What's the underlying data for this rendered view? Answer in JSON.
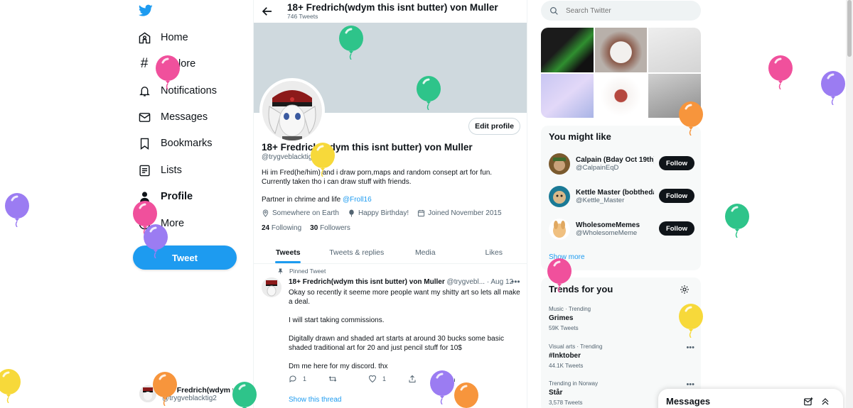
{
  "nav": {
    "items": [
      {
        "label": "Home",
        "icon": "home-icon"
      },
      {
        "label": "Explore",
        "icon": "hashtag-icon"
      },
      {
        "label": "Notifications",
        "icon": "bell-icon"
      },
      {
        "label": "Messages",
        "icon": "envelope-icon"
      },
      {
        "label": "Bookmarks",
        "icon": "bookmark-icon"
      },
      {
        "label": "Lists",
        "icon": "list-icon"
      },
      {
        "label": "Profile",
        "icon": "person-icon"
      },
      {
        "label": "More",
        "icon": "more-circle-icon"
      }
    ],
    "tweet_button": "Tweet",
    "account": {
      "name": "18+ Fredrich(wdym t",
      "handle": "@trygveblacktig2"
    }
  },
  "header": {
    "title": "18+ Fredrich(wdym this isnt butter) von Muller",
    "subtitle": "746 Tweets"
  },
  "profile": {
    "edit_button": "Edit profile",
    "name": "18+ Fredrich(wdym this isnt butter) von Muller",
    "handle": "@trygveblacktig2",
    "bio": "Hi im Fred(he/him) and i draw porn,maps and random consept art for fun. Currently taken tho i can draw stuff with friends.",
    "partner_text": "Partner in chrime and life ",
    "partner_link": "@Froll16",
    "location": "Somewhere on Earth",
    "birthday": "Happy Birthday!",
    "joined": "Joined November 2015",
    "following_count": "24",
    "following_label": "Following",
    "followers_count": "30",
    "followers_label": "Followers"
  },
  "tabs": [
    "Tweets",
    "Tweets & replies",
    "Media",
    "Likes"
  ],
  "tweet": {
    "pinned_label": "Pinned Tweet",
    "author": "18+ Fredrich(wdym this isnt butter) von Muller",
    "meta": "@trygvebl... · Aug 12",
    "paragraphs": [
      "Okay so recently it seeme more people want my shitty art so lets all make a deal.",
      "I will start taking commissions.",
      "Digitally drawn and shaded art starts at around 30 bucks some basic shaded traditional art for 20 and just pencil stuff for 10$",
      "Dm me here for my discord. thx"
    ],
    "reply_count": "1",
    "like_count": "1",
    "show_thread": "Show this thread"
  },
  "search": {
    "placeholder": "Search Twitter"
  },
  "you_might_like": {
    "title": "You might like",
    "users": [
      {
        "name": "Calpain (Bday Oct 19th)",
        "handle": "@CalpainEqD",
        "button": "Follow"
      },
      {
        "name": "Kettle Master (bobthedan",
        "handle": "@Kettle_Master",
        "button": "Follow"
      },
      {
        "name": "WholesomeMemes",
        "handle": "@WholesomeMeme",
        "button": "Follow"
      }
    ],
    "show_more": "Show more"
  },
  "trends": {
    "title": "Trends for you",
    "items": [
      {
        "context": "Music · Trending",
        "topic": "Grimes",
        "count": "59K Tweets"
      },
      {
        "context": "Visual arts · Trending",
        "topic": "#Inktober",
        "count": "44.1K Tweets"
      },
      {
        "context": "Trending in Norway",
        "topic": "Står",
        "count": "3,578 Tweets"
      }
    ]
  },
  "messages_drawer": {
    "label": "Messages"
  },
  "colors": {
    "accent": "#1d9bf0",
    "dark": "#0f1419",
    "muted": "#536471",
    "balloon_pink": "#f0509c",
    "balloon_green": "#2ec48a",
    "balloon_purple": "#9b7cf2",
    "balloon_yellow": "#f7d93a",
    "balloon_orange": "#f7953c"
  }
}
